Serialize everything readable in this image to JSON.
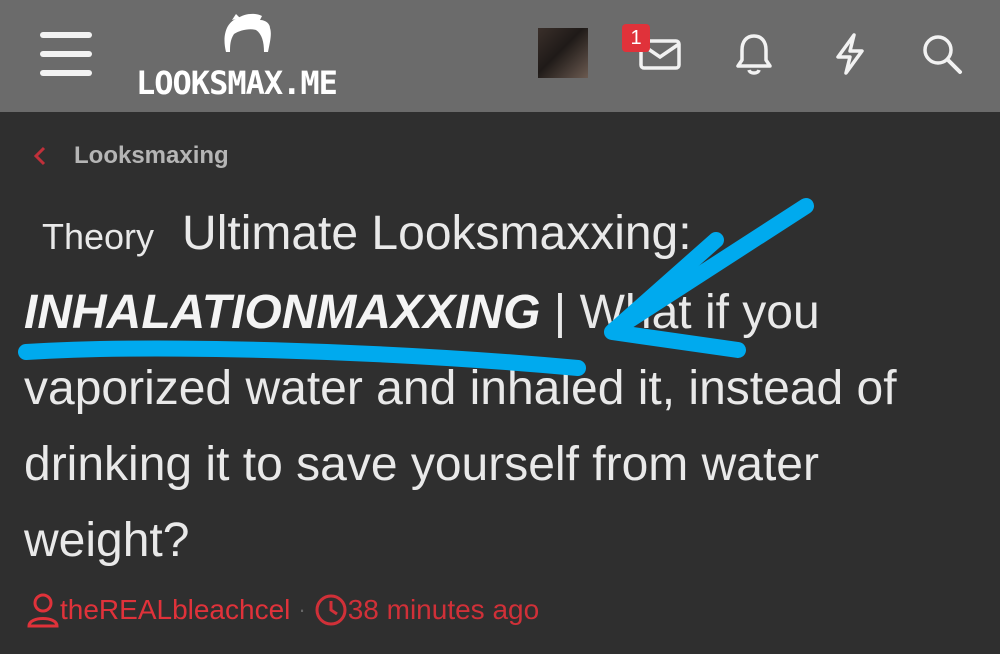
{
  "header": {
    "logo_text": "LOOKSMAX.ME",
    "inbox_badge": "1",
    "icons": [
      "menu-icon",
      "avatar",
      "inbox-icon",
      "bell-icon",
      "lightning-icon",
      "search-icon"
    ]
  },
  "breadcrumb": {
    "label": "Looksmaxing"
  },
  "thread": {
    "prefix": "Theory",
    "title_part1": "Ultimate Looksmaxxing:",
    "title_bold": "INHALATIONMAXXING",
    "title_part2": "| What if you vaporized water and inhaled it, instead of drinking it to save yourself from water weight?",
    "author": "theREALbleachcel",
    "separator": "·",
    "time": "38 minutes ago"
  },
  "colors": {
    "header_bg": "#6b6b6b",
    "page_bg": "#2f2f2f",
    "accent_red": "#e0323a",
    "annotation_blue": "#00aaee"
  }
}
